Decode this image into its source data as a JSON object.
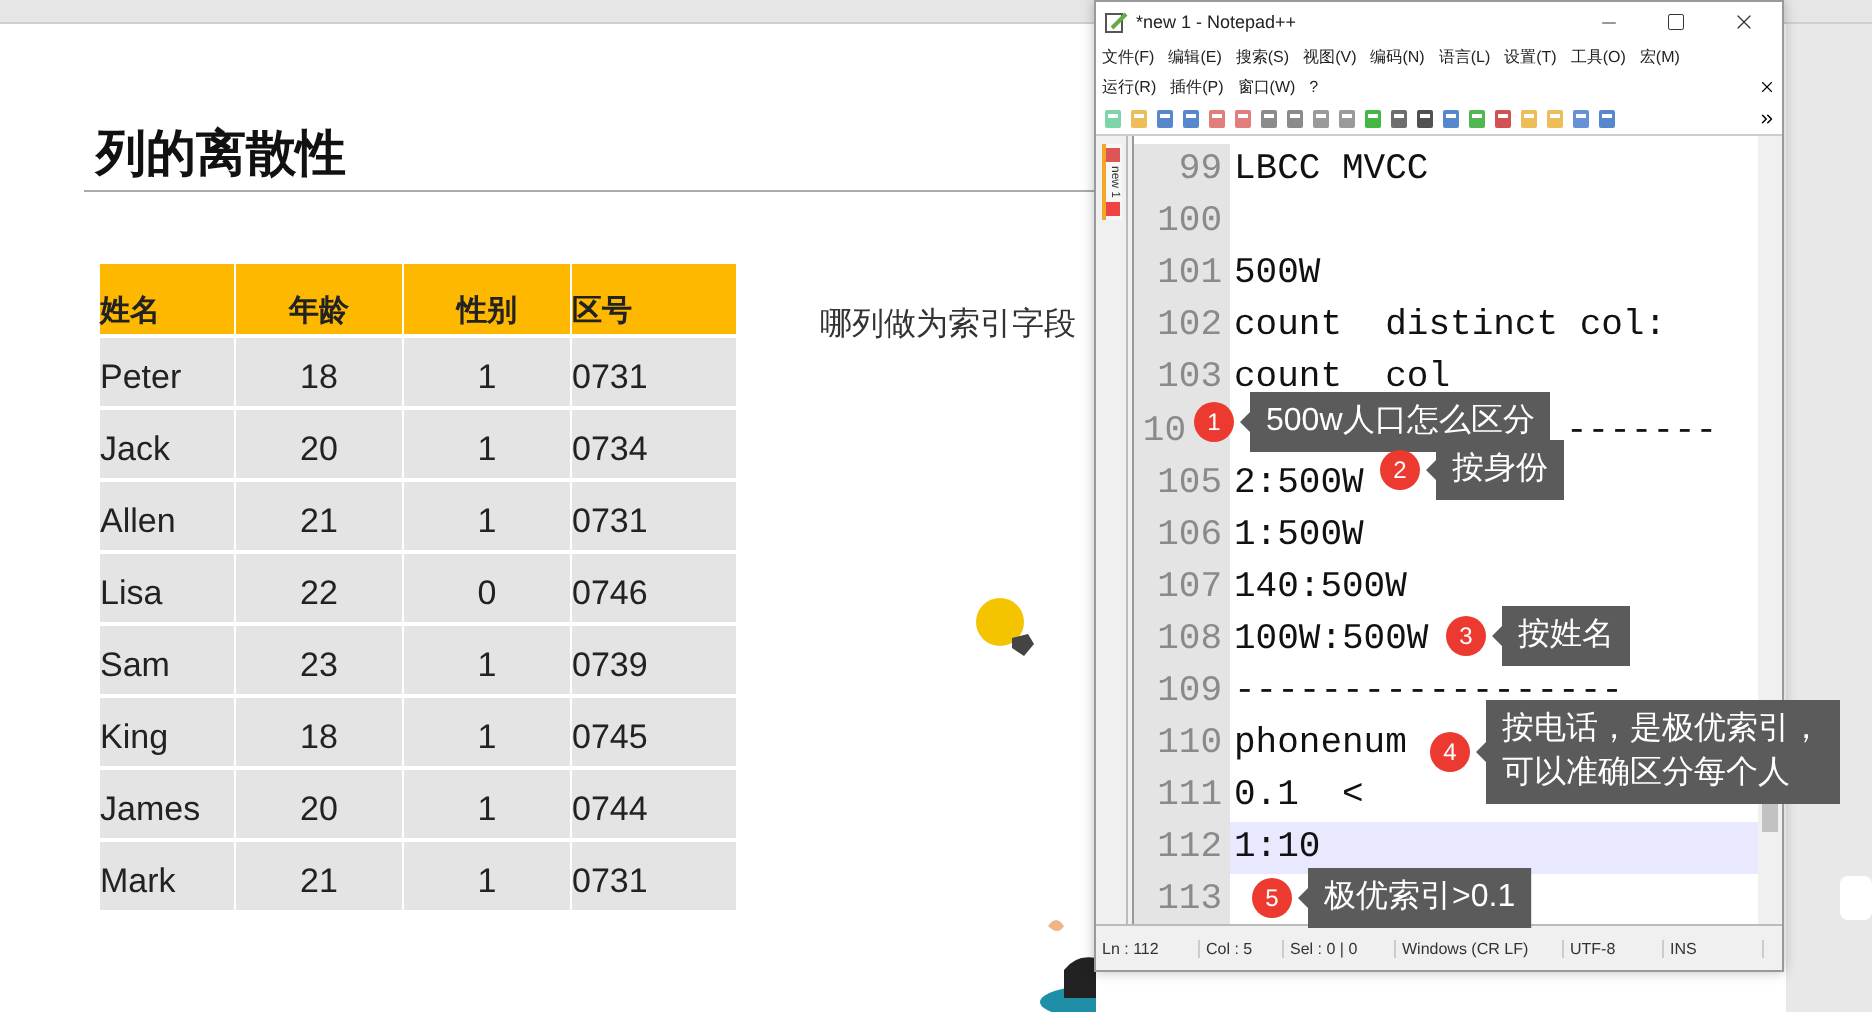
{
  "slide": {
    "title": "列的离散性",
    "question": "哪列做为索引字段",
    "table": {
      "columns": [
        "姓名",
        "年龄",
        "性别",
        "区号"
      ],
      "rows": [
        [
          "Peter",
          "18",
          "1",
          "0731"
        ],
        [
          "Jack",
          "20",
          "1",
          "0734"
        ],
        [
          "Allen",
          "21",
          "1",
          "0731"
        ],
        [
          "Lisa",
          "22",
          "0",
          "0746"
        ],
        [
          "Sam",
          "23",
          "1",
          "0739"
        ],
        [
          "King",
          "18",
          "1",
          "0745"
        ],
        [
          "James",
          "20",
          "1",
          "0744"
        ],
        [
          "Mark",
          "21",
          "1",
          "0731"
        ]
      ]
    }
  },
  "editor_window": {
    "title": "*new 1 - Notepad++",
    "menus": [
      [
        "文件(F)",
        "编辑(E)",
        "搜索(S)",
        "视图(V)",
        "编码(N)",
        "语言(L)",
        "设置(T)",
        "工具(O)",
        "宏(M)"
      ],
      [
        "运行(R)",
        "插件(P)",
        "窗口(W)",
        "?"
      ]
    ],
    "tab": "new 1",
    "lines": [
      {
        "number": "99",
        "text": "LBCC MVCC",
        "selected": false
      },
      {
        "number": "100",
        "selected": false
      },
      {
        "number": "101",
        "text": "500W",
        "selected": false
      },
      {
        "number": "102",
        "text": "count  distinct col:",
        "selected": false
      },
      {
        "number": "103",
        "text": "count  col",
        "selected": false
      },
      {
        "number": "10",
        "text": "-------",
        "selected": false
      },
      {
        "number": "105",
        "text": "2:500W",
        "selected": false
      },
      {
        "number": "106",
        "text": "1:500W",
        "selected": false
      },
      {
        "number": "107",
        "text": "140:500W",
        "selected": false
      },
      {
        "number": "108",
        "text": "100W:500W",
        "selected": false
      },
      {
        "number": "109",
        "text": "------------------",
        "selected": false
      },
      {
        "number": "110",
        "text": "phonenum",
        "selected": false
      },
      {
        "number": "111",
        "text": "0.1  <",
        "selected": false
      },
      {
        "number": "112",
        "text": "1:10",
        "selected": true
      },
      {
        "number": "113",
        "selected": false
      }
    ],
    "status_bar": [
      "Ln : 112",
      "Col : 5",
      "Sel : 0 | 0",
      "Windows (CR LF)",
      "UTF-8",
      "INS"
    ]
  },
  "callouts": [
    {
      "number": "1",
      "text": "500w人口怎么区分"
    },
    {
      "number": "2",
      "text": "按身份"
    },
    {
      "number": "3",
      "text": "按姓名"
    },
    {
      "number": "4",
      "text": "按电话，是极优索引，可以准确区分每个人"
    },
    {
      "number": "5",
      "text": "极优索引>0.1"
    }
  ]
}
